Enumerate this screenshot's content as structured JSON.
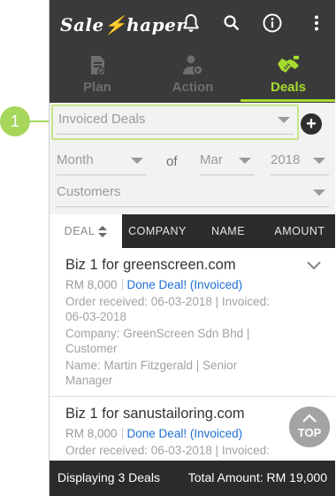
{
  "app": {
    "logo_text_a": "Sale",
    "logo_text_b": "haper"
  },
  "tabs": [
    {
      "label": "Plan",
      "icon": "plan-document-icon",
      "active": false
    },
    {
      "label": "Action",
      "icon": "action-person-icon",
      "active": false
    },
    {
      "label": "Deals",
      "icon": "handshake-icon",
      "active": true
    }
  ],
  "filters": {
    "deal_type": "Invoiced Deals",
    "period": "Month",
    "of_label": "of",
    "month": "Mar",
    "year": "2018",
    "customer": "Customers"
  },
  "columns": [
    "DEAL",
    "COMPANY",
    "NAME",
    "AMOUNT"
  ],
  "deals": [
    {
      "title": "Biz 1 for greenscreen.com",
      "amount": "RM 8,000",
      "status": "Done Deal! (Invoiced)",
      "dates": "Order received: 06-03-2018 | Invoiced: 06-03-2018",
      "company": "Company: GreenScreen Sdn Bhd | Customer",
      "name": "Name: Martin Fitzgerald | Senior Manager"
    },
    {
      "title": "Biz 1 for sanustailoring.com",
      "amount": "RM 8,000",
      "status": "Done Deal! (Invoiced)",
      "dates": "Order received: 06-03-2018 | Invoiced:"
    }
  ],
  "top_button": "TOP",
  "footer": {
    "count": "Displaying 3 Deals",
    "total": "Total Amount: RM 19,000"
  },
  "callout": {
    "number": "1"
  },
  "colors": {
    "accent": "#a6dc2e",
    "topbar": "#3a3a3a",
    "link": "#1f6fd1",
    "callout": "#a6d75b"
  }
}
